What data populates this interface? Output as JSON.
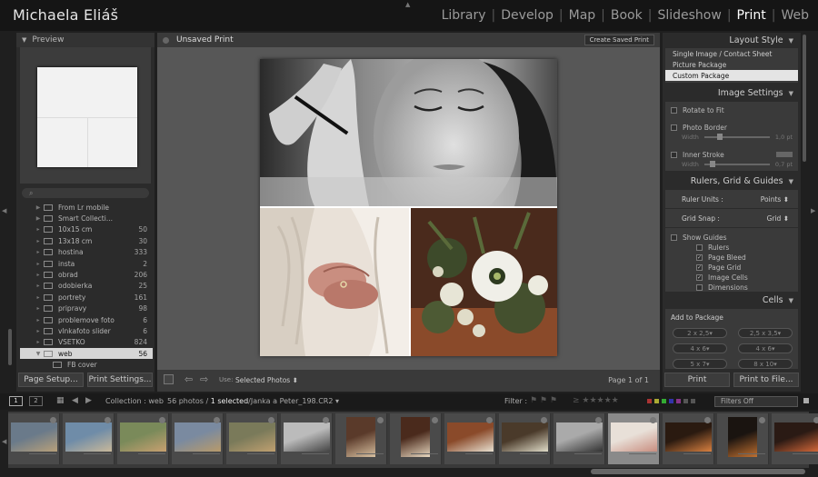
{
  "app": {
    "identity_plate": "Michaela Eliáš",
    "modules": [
      "Library",
      "Develop",
      "Map",
      "Book",
      "Slideshow",
      "Print",
      "Web"
    ],
    "active_module": "Print"
  },
  "left_panel": {
    "preview_title": "Preview",
    "collections": [
      {
        "name": "From Lr mobile",
        "count": "",
        "type": "set"
      },
      {
        "name": "Smart Collecti...",
        "count": "",
        "type": "set"
      },
      {
        "name": "10x15 cm",
        "count": "50",
        "type": "folder"
      },
      {
        "name": "13x18 cm",
        "count": "30",
        "type": "folder"
      },
      {
        "name": "hostina",
        "count": "333",
        "type": "folder"
      },
      {
        "name": "insta",
        "count": "2",
        "type": "folder"
      },
      {
        "name": "obrad",
        "count": "206",
        "type": "folder"
      },
      {
        "name": "odobierka",
        "count": "25",
        "type": "folder"
      },
      {
        "name": "portrety",
        "count": "161",
        "type": "folder"
      },
      {
        "name": "pripravy",
        "count": "98",
        "type": "folder"
      },
      {
        "name": "problemove foto",
        "count": "6",
        "type": "folder"
      },
      {
        "name": "vlnkafoto slider",
        "count": "6",
        "type": "folder"
      },
      {
        "name": "VSETKO",
        "count": "824",
        "type": "folder"
      },
      {
        "name": "web",
        "count": "56",
        "type": "set",
        "selected": true
      },
      {
        "name": "FB cover",
        "count": "",
        "type": "child"
      }
    ],
    "page_setup_label": "Page Setup...",
    "print_settings_label": "Print Settings..."
  },
  "center": {
    "title": "Unsaved Print",
    "create_saved_label": "Create Saved Print",
    "use_label": "Use:",
    "use_value": "Selected Photos",
    "page_indicator": "Page 1 of 1"
  },
  "right_panel": {
    "layout_style": {
      "title": "Layout Style",
      "options": [
        "Single Image / Contact Sheet",
        "Picture Package",
        "Custom Package"
      ],
      "selected": "Custom Package"
    },
    "image_settings": {
      "title": "Image Settings",
      "rotate_to_fit": "Rotate to Fit",
      "photo_border": "Photo Border",
      "width_label": "Width",
      "border_width_value": "1,0 pt",
      "inner_stroke": "Inner Stroke",
      "stroke_width_value": "0,7 pt"
    },
    "rulers": {
      "title": "Rulers, Grid & Guides",
      "ruler_units_label": "Ruler Units :",
      "ruler_units_value": "Points",
      "grid_snap_label": "Grid Snap :",
      "grid_snap_value": "Grid",
      "show_guides": "Show Guides",
      "guides": [
        {
          "label": "Rulers",
          "checked": false
        },
        {
          "label": "Page Bleed",
          "checked": true
        },
        {
          "label": "Page Grid",
          "checked": true
        },
        {
          "label": "Image Cells",
          "checked": true
        },
        {
          "label": "Dimensions",
          "checked": false
        }
      ]
    },
    "cells": {
      "title": "Cells",
      "add_to_package": "Add to Package",
      "sizes": [
        "2 x 2,5",
        "2,5 x 3,5",
        "4 x 6",
        "4 x 6",
        "5 x 7",
        "8 x 10"
      ]
    },
    "print_label": "Print",
    "print_to_file_label": "Print to File..."
  },
  "filmstrip": {
    "view1": "1",
    "view2": "2",
    "collection_label": "Collection : web",
    "status_count": "56 photos /",
    "status_selected": "1 selected",
    "status_file": "/Janka a Peter_198.CR2",
    "filter_label": "Filter :",
    "filters_off": "Filters Off"
  }
}
